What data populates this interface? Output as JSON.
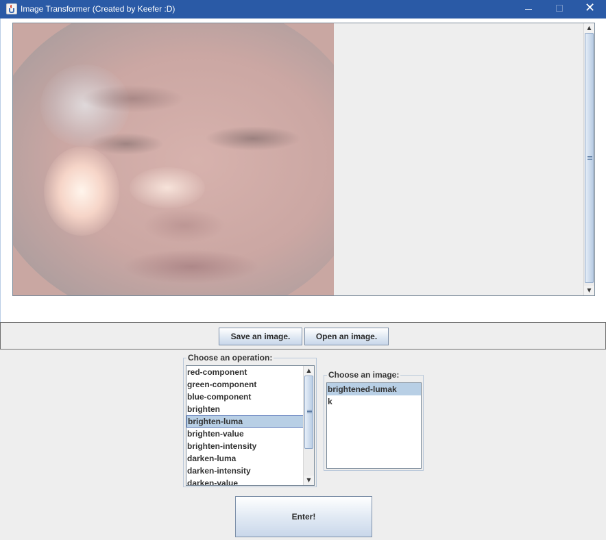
{
  "window": {
    "title": "Image Transformer (Created by Keefer :D)",
    "icon": "java-cup-icon",
    "controls": {
      "minimize": "minimize-icon",
      "maximize": "maximize-icon",
      "close": "✕"
    }
  },
  "toolbar": {
    "save_label": "Save an image.",
    "open_label": "Open an image."
  },
  "operations": {
    "title": "Choose an operation:",
    "items": [
      "red-component",
      "green-component",
      "blue-component",
      "brighten",
      "brighten-luma",
      "brighten-value",
      "brighten-intensity",
      "darken-luma",
      "darken-intensity",
      "darken-value"
    ],
    "selected": "brighten-luma",
    "scroll_glyphs": {
      "up": "▲",
      "down": "▼"
    }
  },
  "images": {
    "title": "Choose an image:",
    "items": [
      "brightened-lumak",
      "k"
    ],
    "selected": "brightened-lumak"
  },
  "enter_label": "Enter!",
  "colors": {
    "title_bar": "#2a5aa6",
    "selection": "#b8cfe5",
    "panel_background": "#eeeeee"
  }
}
